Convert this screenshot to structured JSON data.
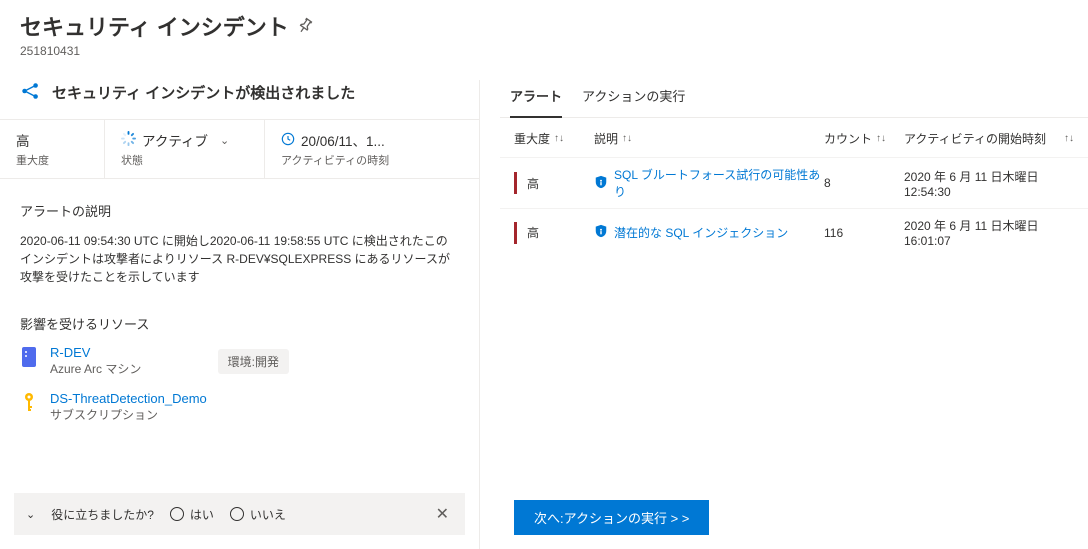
{
  "header": {
    "title": "セキュリティ インシデント",
    "id": "251810431"
  },
  "incident": {
    "detected_title": "セキュリティ インシデントが検出されました"
  },
  "metrics": {
    "severity": {
      "value": "高",
      "label": "重大度"
    },
    "status": {
      "value": "アクティブ",
      "label": "状態"
    },
    "time": {
      "value": "20/06/11、1...",
      "label": "アクティビティの時刻"
    }
  },
  "description": {
    "heading": "アラートの説明",
    "text": "2020-06-11 09:54:30 UTC に開始し2020-06-11 19:58:55 UTC に検出されたこのインシデントは攻撃者によりリソース R-DEV¥SQLEXPRESS にあるリソースが攻撃を受けたことを示しています"
  },
  "resources": {
    "heading": "影響を受けるリソース",
    "items": [
      {
        "name": "R-DEV",
        "type": "Azure Arc マシン",
        "tag": "環境:開発",
        "icon": "server"
      },
      {
        "name": "DS-ThreatDetection_Demo",
        "type": "サブスクリプション",
        "tag": "",
        "icon": "key"
      }
    ]
  },
  "feedback": {
    "question": "役に立ちましたか?",
    "yes": "はい",
    "no": "いいえ"
  },
  "tabs": {
    "alerts": "アラート",
    "actions": "アクションの実行"
  },
  "table": {
    "headers": {
      "severity": "重大度",
      "description": "説明",
      "count": "カウント",
      "time": "アクティビティの開始時刻"
    },
    "rows": [
      {
        "severity": "高",
        "label": "SQL ブルートフォース試行の可能性あり",
        "count": "8",
        "time": "2020 年 6 月 11 日木曜日 12:54:30"
      },
      {
        "severity": "高",
        "label": "潜在的な SQL インジェクション",
        "count": "116",
        "time": "2020 年 6 月 11 日木曜日 16:01:07"
      }
    ]
  },
  "action_button": "次へ:アクションの実行 > >"
}
